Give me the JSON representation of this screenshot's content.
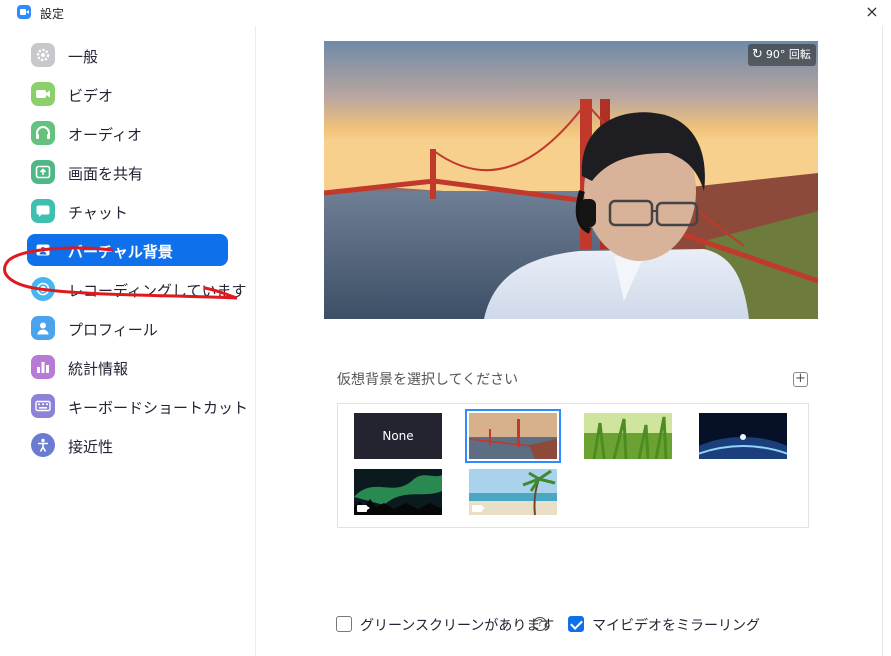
{
  "window": {
    "title": "設定",
    "close_glyph": "×"
  },
  "sidebar": {
    "items": [
      {
        "label": "一般",
        "icon": "gear-icon",
        "color": "#C8C8CC",
        "active": false
      },
      {
        "label": "ビデオ",
        "icon": "video-camera-icon",
        "color": "#8BD06B",
        "active": false
      },
      {
        "label": "オーディオ",
        "icon": "headphones-icon",
        "color": "#65C27E",
        "active": false
      },
      {
        "label": "画面を共有",
        "icon": "share-screen-icon",
        "color": "#4FB885",
        "active": false
      },
      {
        "label": "チャット",
        "icon": "chat-bubble-icon",
        "color": "#3FBFB0",
        "active": false
      },
      {
        "label": "バーチャル背景",
        "icon": "virtual-background-icon",
        "color": "#0E71EB",
        "active": true
      },
      {
        "label": "レコーディングしています",
        "icon": "record-icon",
        "color": "#47B6F0",
        "active": false
      },
      {
        "label": "プロフィール",
        "icon": "profile-icon",
        "color": "#4BA3EE",
        "active": false
      },
      {
        "label": "統計情報",
        "icon": "statistics-icon",
        "color": "#B77BD6",
        "active": false
      },
      {
        "label": "キーボードショートカット",
        "icon": "keyboard-icon",
        "color": "#8C82D8",
        "active": false
      },
      {
        "label": "接近性",
        "icon": "accessibility-icon",
        "color": "#6C7BD2",
        "active": false
      }
    ]
  },
  "preview": {
    "rotate_label": "90° 回転"
  },
  "backgrounds": {
    "heading": "仮想背景を選択してください",
    "add_glyph": "+",
    "items": [
      {
        "label": "None",
        "kind": "none",
        "selected": false
      },
      {
        "label": "",
        "kind": "golden-gate",
        "selected": true
      },
      {
        "label": "",
        "kind": "grass",
        "selected": false
      },
      {
        "label": "",
        "kind": "earth",
        "selected": false
      },
      {
        "label": "",
        "kind": "aurora",
        "selected": false,
        "video": true
      },
      {
        "label": "",
        "kind": "beach",
        "selected": false,
        "video": true
      }
    ]
  },
  "options": {
    "green_screen": {
      "label": "グリーンスクリーンがあります",
      "checked": false
    },
    "help_glyph": "?",
    "mirror": {
      "label": "マイビデオをミラーリング",
      "checked": true
    }
  },
  "colors": {
    "accent": "#0E71EB",
    "annotation": "#E0191E"
  }
}
